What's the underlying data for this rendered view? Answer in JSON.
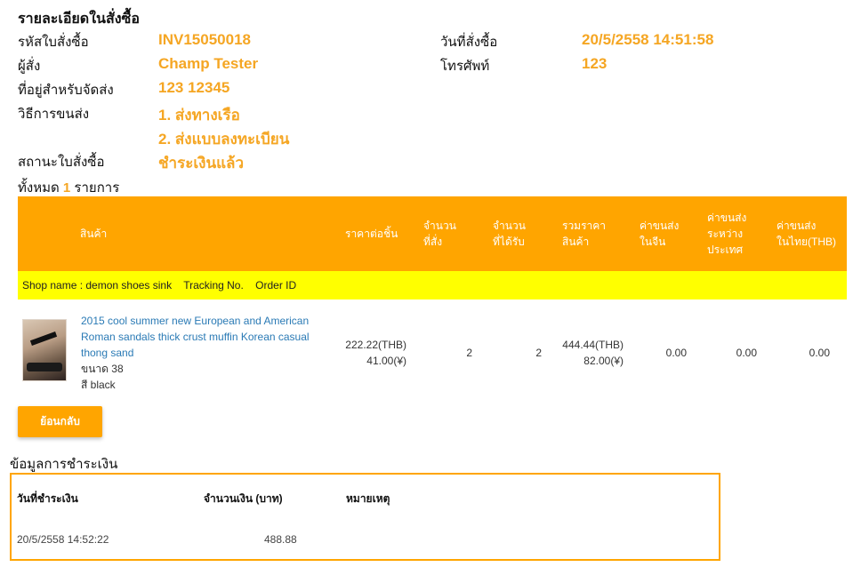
{
  "order": {
    "title": "รายละเอียดในสั่งซื้อ",
    "fields": {
      "invoice_label": "รหัสใบสั่งซื้อ",
      "invoice_value": "INV15050018",
      "orderer_label": "ผู้สั่ง",
      "orderer_value": "Champ Tester",
      "address_label": "ที่อยู่สำหรับจัดส่ง",
      "address_value": "123 12345",
      "shipping_label": "วิธีการขนส่ง",
      "shipping_value_1": "1. ส่งทางเรือ",
      "shipping_value_2": "2. ส่งแบบลงทะเบียน",
      "status_label": "สถานะใบสั่งซื้อ",
      "status_value": "ชำระเงินแล้ว",
      "date_label": "วันที่สั่งซื้อ",
      "date_value": "20/5/2558 14:51:58",
      "phone_label": "โทรศัพท์",
      "phone_value": "123"
    },
    "count_prefix": "ทั้งหมด",
    "count_value": "1",
    "count_suffix": "รายการ"
  },
  "table": {
    "headers": {
      "product": "สินค้า",
      "unit_price": "ราคาต่อชิ้น",
      "qty_ordered_1": "จำนวน",
      "qty_ordered_2": "ที่สั่ง",
      "qty_received_1": "จำนวน",
      "qty_received_2": "ที่ได้รับ",
      "total_1": "รวมราคา",
      "total_2": "สินค้า",
      "ship_cn_1": "ค่าขนส่ง",
      "ship_cn_2": "ในจีน",
      "ship_intl_1": "ค่าขนส่ง",
      "ship_intl_2": "ระหว่าง",
      "ship_intl_3": "ประเทศ",
      "ship_th_1": "ค่าขนส่ง",
      "ship_th_2": "ในไทย(THB)"
    },
    "shop_row": {
      "shop_name": "Shop name : demon shoes sink",
      "tracking": "Tracking No.",
      "order_id": "Order ID"
    },
    "item": {
      "name": "2015 cool summer new European and American Roman sandals thick crust muffin Korean casual thong sand",
      "size": "ขนาด 38",
      "color": "สี black",
      "unit_price_thb": "222.22(THB)",
      "unit_price_cny": "41.00(¥)",
      "qty_ordered": "2",
      "qty_received": "2",
      "total_thb": "444.44(THB)",
      "total_cny": "82.00(¥)",
      "ship_cn": "0.00",
      "ship_intl": "0.00",
      "ship_th": "0.00"
    }
  },
  "back_button": "ย้อนกลับ",
  "payment": {
    "title": "ข้อมูลการชำระเงิน",
    "headers": {
      "date": "วันที่ชำระเงิน",
      "amount": "จำนวนเงิน (บาท)",
      "note": "หมายเหตุ"
    },
    "row": {
      "date": "20/5/2558 14:52:22",
      "amount": "488.88",
      "note": ""
    }
  },
  "colors": {
    "accent": "#ffa500",
    "highlight_row": "#ffff00",
    "value_text": "#f5a623",
    "link": "#2a7ab5"
  }
}
